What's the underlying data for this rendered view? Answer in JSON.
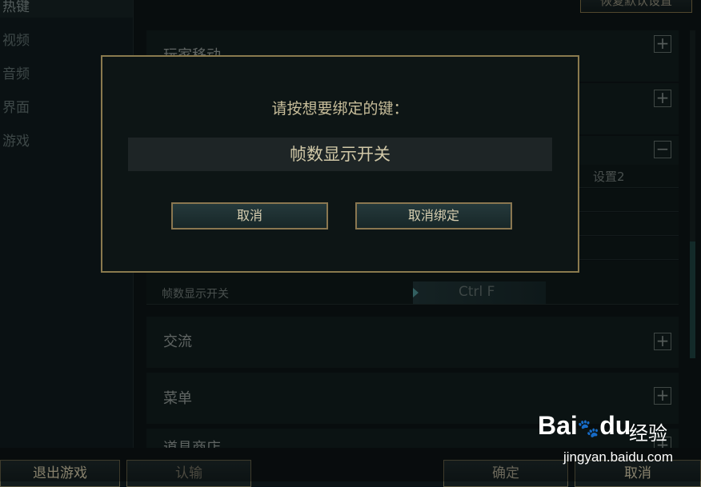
{
  "sidebar": {
    "items": [
      "热键",
      "视频",
      "音频",
      "界面",
      "游戏"
    ]
  },
  "top": {
    "reset_label": "恢复默认设置"
  },
  "sections": [
    {
      "title": "玩家移动",
      "toggle": "+"
    },
    {
      "title": "",
      "toggle": "+"
    },
    {
      "title": "",
      "toggle": "−"
    },
    {
      "title": "交流",
      "toggle": "+"
    },
    {
      "title": "菜单",
      "toggle": "+"
    },
    {
      "title": "道具商店",
      "toggle": "+"
    }
  ],
  "binding_table": {
    "column_setting2": "设置2",
    "row_label": "帧数显示开关",
    "row_key": "Ctrl  F"
  },
  "bottom": {
    "exit_label": "退出游戏",
    "surrender_label": "认输",
    "ok_label": "确定",
    "cancel_label": "取消"
  },
  "dialog": {
    "title": "请按想要绑定的键：",
    "action_name": "帧数显示开关",
    "cancel_label": "取消",
    "unbind_label": "取消绑定"
  },
  "watermark": {
    "logo": "Bai",
    "logo_suffix": "du",
    "brand": "经验",
    "url": "jingyan.baidu.com"
  }
}
